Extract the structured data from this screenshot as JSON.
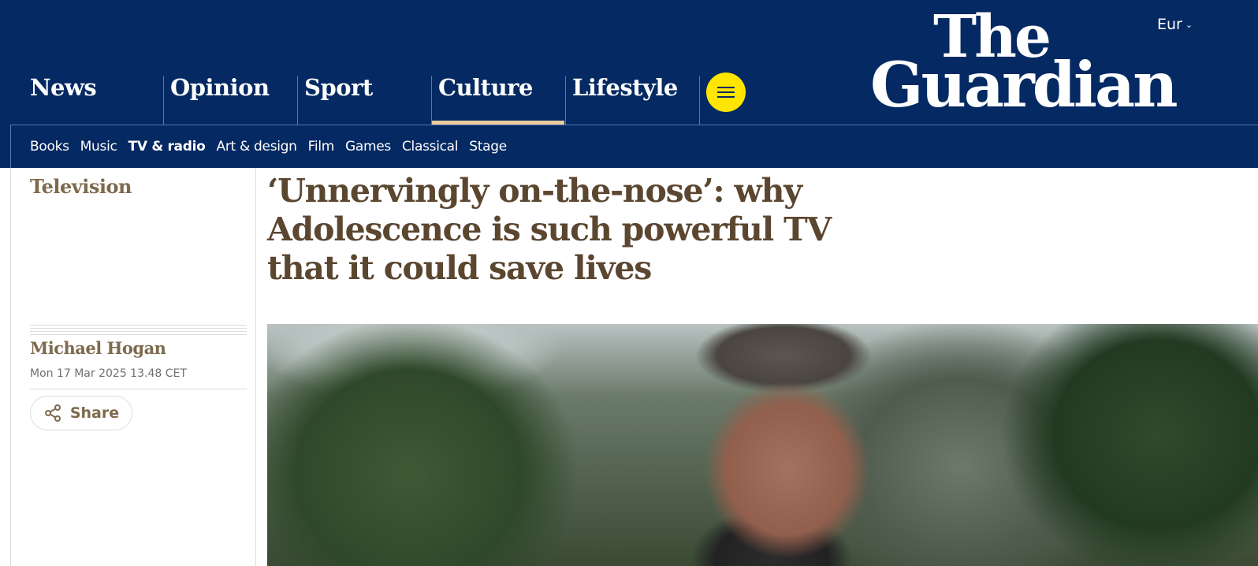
{
  "header": {
    "edition": "Eur",
    "logo_line1": "The",
    "logo_line2": "Guardian",
    "pillars": [
      "News",
      "Opinion",
      "Sport",
      "Culture",
      "Lifestyle"
    ],
    "active_pillar": "Culture",
    "accent_color": "#052962",
    "active_underline_color": "#eacca0",
    "menu_button_color": "#ffe500"
  },
  "subnav": {
    "items": [
      "Books",
      "Music",
      "TV & radio",
      "Art & design",
      "Film",
      "Games",
      "Classical",
      "Stage"
    ],
    "active": "TV & radio"
  },
  "article": {
    "section": "Television",
    "headline": "‘Unnervingly on-the-nose’: why Adolescence is such powerful TV that it could save lives",
    "byline": "Michael Hogan",
    "date": "Mon 17 Mar 2025 13.48 CET",
    "share_label": "Share",
    "culture_color": "#7d6a4d"
  }
}
